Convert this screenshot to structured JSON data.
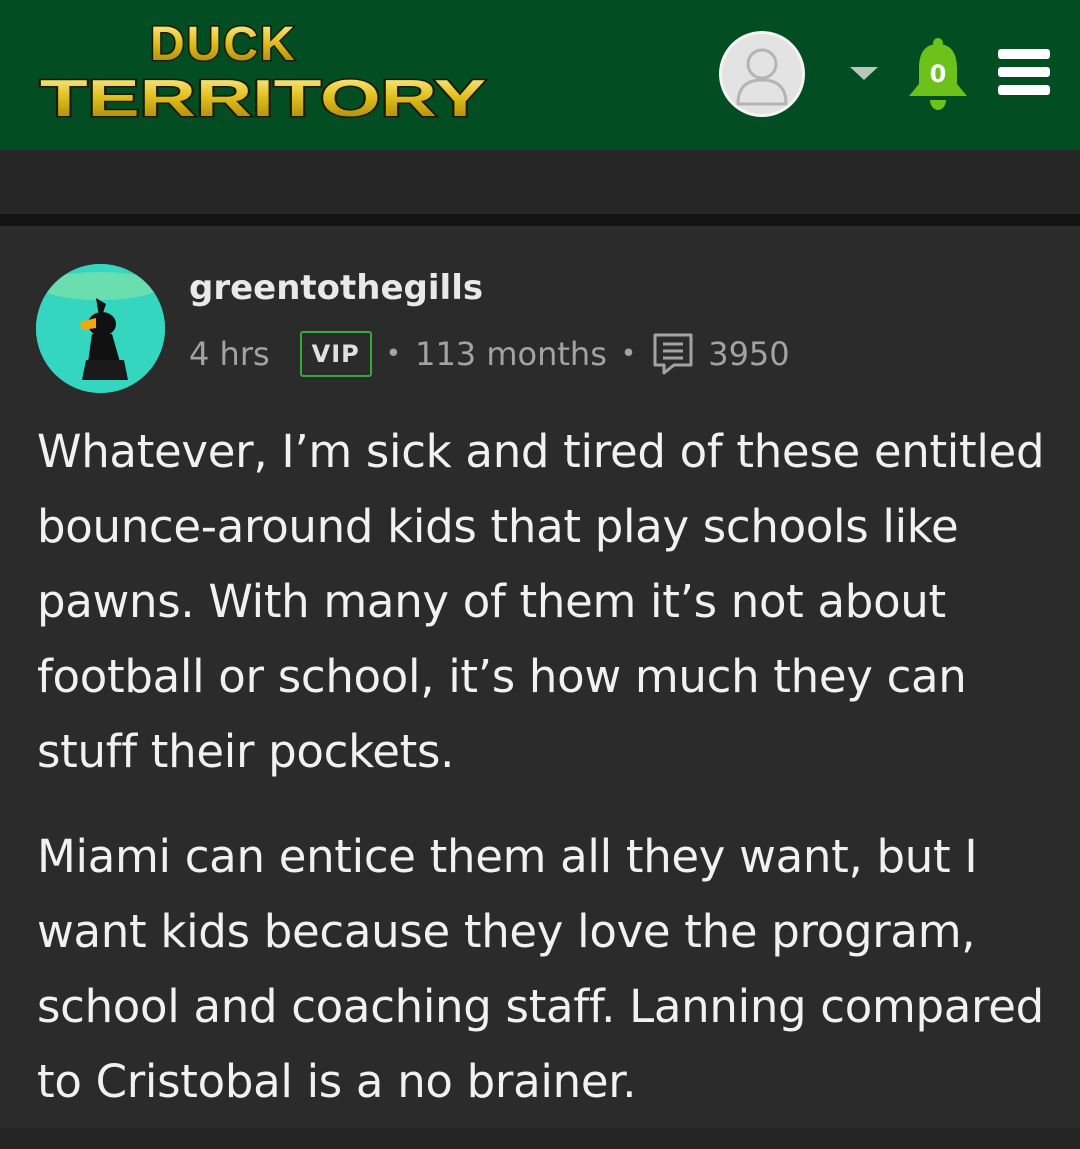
{
  "header": {
    "logo_text_top": "DUCK",
    "logo_text_bottom": "TERRITORY",
    "notification_count": "0",
    "brand_green": "#034d22",
    "bell_color": "#6cc21b",
    "logo_gold": "#e2c11e"
  },
  "post": {
    "author": "greentothegills",
    "time": "4 hrs",
    "badge": "VIP",
    "membership": "113 months",
    "post_count": "3950",
    "paragraphs": [
      "Whatever, I’m sick and tired of these entitled bounce-around kids that play schools like pawns. With many of them it’s not about football or school, it’s how much they can stuff their pockets.",
      "Miami can entice them all they want, but I want kids because they love the program, school and coaching staff. Lanning compared to Cristobal is a no brainer."
    ]
  },
  "icons": {
    "avatar": "user-silhouette-icon",
    "dropdown": "caret-down-icon",
    "notifications": "bell-icon",
    "menu": "hamburger-menu-icon",
    "posts": "comment-icon"
  }
}
